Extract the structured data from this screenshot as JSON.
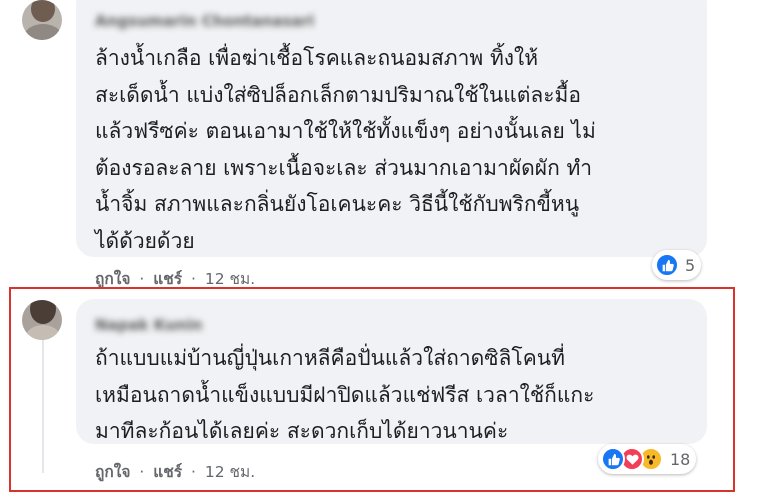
{
  "comments": [
    {
      "author": "Angsumarin Chontanasari",
      "lines": [
        "ล้างน้ำเกลือ เพื่อฆ่าเชื้อโรคและถนอมสภาพ ทิ้งให้",
        "สะเด็ดน้ำ แบ่งใส่ซิปล็อกเล็กตามปริมาณใช้ในแต่ละมื้อ",
        "แล้วฟรีซค่ะ ตอนเอามาใช้ให้ใช้ทั้งแข็งๆ อย่างนั้นเลย ไม่",
        "ต้องรอละลาย เพราะเนื้อจะเละ ส่วนมากเอามาผัดผัก ทำ",
        "น้ำจิ้ม สภาพและกลิ่นยังโอเคนะคะ วิธีนี้ใช้กับพริกขี้หนู",
        "ได้ด้วยด้วย"
      ],
      "like_label": "ถูกใจ",
      "reply_label": "แชร์",
      "separator": "·",
      "timestamp": "12 ชม.",
      "reaction_count": "5",
      "reactions": [
        "like-icon"
      ]
    },
    {
      "author": "Napak Kunin",
      "lines": [
        "ถ้าแบบแม่บ้านญี่ปุ่นเกาหลีคือปั่นแล้วใส่ถาดซิลิโคนที่",
        "เหมือนถาดน้ำแข็งแบบมีฝาปิดแล้วแช่ฟรีส เวลาใช้ก็แกะ",
        "มาทีละก้อนได้เลยค่ะ สะดวกเก็บได้ยาวนานค่ะ"
      ],
      "like_label": "ถูกใจ",
      "reply_label": "แชร์",
      "separator": "·",
      "timestamp": "12 ชม.",
      "reaction_count": "18",
      "reactions": [
        "like-icon",
        "love-icon",
        "wow-icon"
      ]
    }
  ],
  "colors": {
    "bubble": "#f0f2f5",
    "highlight_border": "#d9342b",
    "like_blue": "#1877f2",
    "love_red": "#f33e58",
    "wow_yellow": "#f7b928"
  }
}
